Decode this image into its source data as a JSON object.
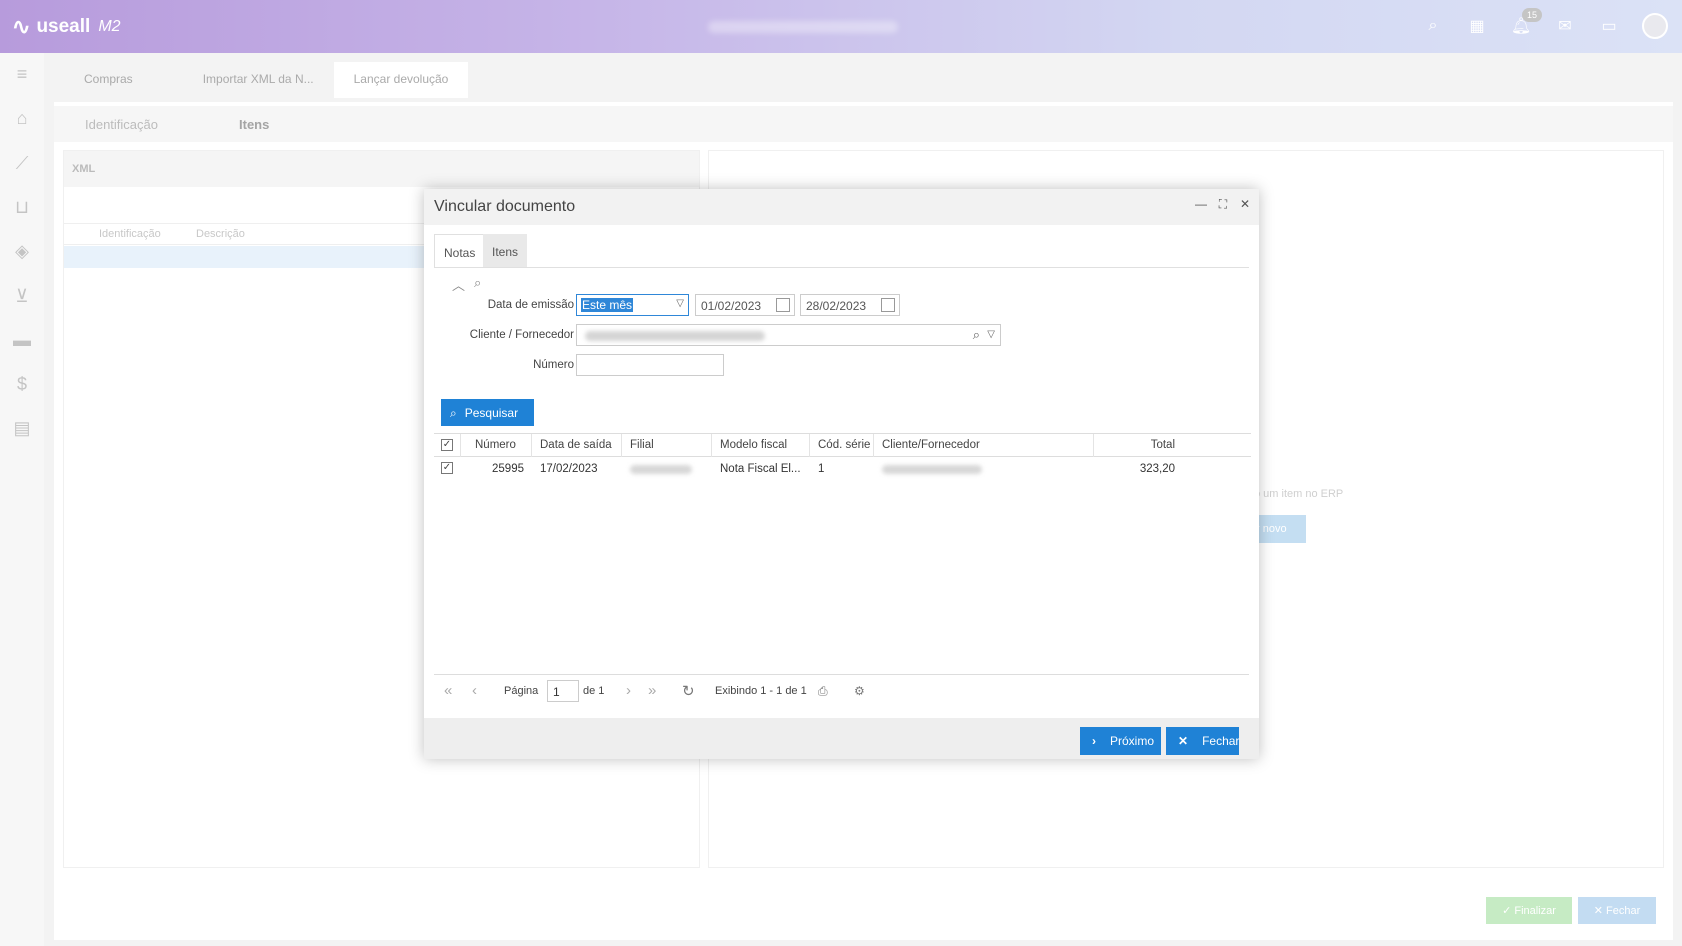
{
  "app": {
    "logo_text": "useall",
    "version": "M2",
    "notification_count": "15"
  },
  "page_tabs": [
    "Compras",
    "Importar XML da N...",
    "Lançar devolução"
  ],
  "sub_tabs": [
    "Identificação",
    "Itens"
  ],
  "left_panel": {
    "title": "XML",
    "columns": [
      "Identificação",
      "Descrição"
    ]
  },
  "right_panel": {
    "hint": "o um item no ERP",
    "button": "r novo"
  },
  "bottom": {
    "finalize": "Finalizar",
    "close": "Fechar"
  },
  "modal": {
    "title": "Vincular documento",
    "tabs": [
      "Notas",
      "Itens"
    ],
    "filters": {
      "emission_label": "Data de emissão",
      "period_value": "Este mês",
      "date_from": "01/02/2023",
      "date_to": "28/02/2023",
      "client_label": "Cliente / Fornecedor",
      "number_label": "Número"
    },
    "search_label": "Pesquisar",
    "grid": {
      "columns": [
        "Número",
        "Data de saída",
        "Filial",
        "Modelo fiscal",
        "Cód. série",
        "Cliente/Fornecedor",
        "Total"
      ],
      "rows": [
        {
          "numero": "25995",
          "data_saida": "17/02/2023",
          "modelo": "Nota Fiscal El...",
          "serie": "1",
          "total": "323,20"
        }
      ]
    },
    "pager": {
      "page_label": "Página",
      "page": "1",
      "of_label": "de 1",
      "showing": "Exibindo 1 - 1 de 1"
    },
    "footer": {
      "next": "Próximo",
      "close": "Fechar"
    }
  }
}
